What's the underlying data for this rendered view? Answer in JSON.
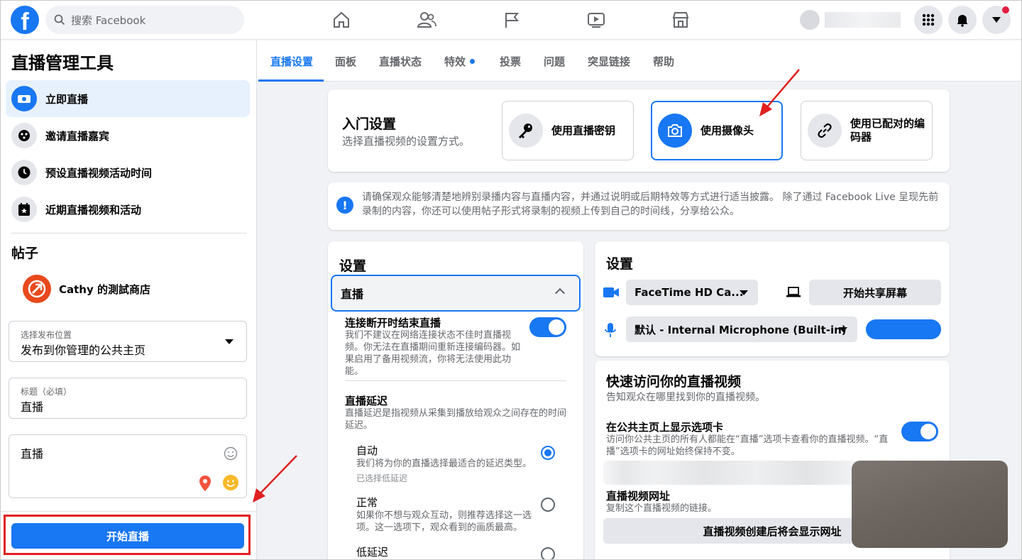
{
  "topbar": {
    "search_placeholder": "搜索 Facebook",
    "icons": [
      "home-icon",
      "friends-icon",
      "pages-flag-icon",
      "watch-icon",
      "marketplace-icon"
    ],
    "right_icons": [
      "menu-grid-icon",
      "bell-icon",
      "account-caret-icon"
    ]
  },
  "sidebar": {
    "title": "直播管理工具",
    "items": [
      {
        "label": "立即直播",
        "icon": "live-camera-icon"
      },
      {
        "label": "邀请直播嘉宾",
        "icon": "guests-icon"
      },
      {
        "label": "预设直播视频活动时间",
        "icon": "clock-icon"
      },
      {
        "label": "近期直播视频和活动",
        "icon": "calendar-star-icon"
      }
    ],
    "posts_heading": "帖子",
    "page_name": "Cathy 的測試商店",
    "post_location": {
      "label": "选择发布位置",
      "value": "发布到你管理的公共主页"
    },
    "title_field": {
      "label": "标题（必填）",
      "value": "直播"
    },
    "description": "直播",
    "go_live_label": "开始直播"
  },
  "tabs": [
    {
      "label": "直播设置",
      "active": true
    },
    {
      "label": "面板"
    },
    {
      "label": "直播状态"
    },
    {
      "label": "特效",
      "dot": true
    },
    {
      "label": "投票"
    },
    {
      "label": "问题"
    },
    {
      "label": "突显链接"
    },
    {
      "label": "帮助"
    }
  ],
  "setup": {
    "title": "入门设置",
    "subtitle": "选择直播视频的设置方式。",
    "methods": [
      {
        "label": "使用直播密钥",
        "icon": "key-icon"
      },
      {
        "label": "使用摄像头",
        "icon": "camera-icon",
        "selected": true
      },
      {
        "label": "使用已配对的编码器",
        "icon": "link-icon"
      }
    ]
  },
  "notice": {
    "text": "请确保观众能够清楚地辨别录播内容与直播内容，并通过说明或后期特效等方式进行适当披露。 除了通过 Facebook Live 呈现先前录制的内容，你还可以使用帖子形式将录制的视频上传到自己的时间线，分享给公众。"
  },
  "settings_left": {
    "title": "设置",
    "section": "直播",
    "end_on_disconnect": {
      "title": "连接断开时结束直播",
      "desc": "我们不建议在网络连接状态不佳时直播视频。你无法在直播期间重新连接编码器。如果启用了备用视频流，你将无法使用此功能。",
      "enabled": true
    },
    "latency": {
      "title": "直播延迟",
      "desc": "直播延迟是指视频从采集到播放给观众之间存在的时间延迟。",
      "options": [
        {
          "title": "自动",
          "desc": "我们将为你的直播选择最适合的延迟类型。",
          "note": "已选择低延迟",
          "selected": true
        },
        {
          "title": "正常",
          "desc": "如果你不想与观众互动，则推荐选择这一选项。这一选项下，观众看到的画质最高。",
          "selected": false
        },
        {
          "title": "低延迟",
          "selected": false
        }
      ]
    }
  },
  "settings_right": {
    "title": "设置",
    "camera": "FaceTime HD Ca...",
    "share_screen": "开始共享屏幕",
    "microphone": "默认 - Internal Microphone (Built-in)",
    "mic_level": 1.0
  },
  "quick_access": {
    "title": "快速访问你的直播视频",
    "subtitle": "告知观众在哪里找到你的直播视频。",
    "show_tab": {
      "title": "在公共主页上显示选项卡",
      "desc": "访问你公共主页的所有人都能在“直播”选项卡查看你的直播视频。“直播”选项卡的网址始终保持不变。",
      "enabled": true
    },
    "url_title": "直播视频网址",
    "url_desc": "复制这个直播视频的链接。",
    "url_button": "直播视频创建后将会显示网址"
  },
  "colors": {
    "accent": "#1877f2",
    "annotation": "#e02020"
  }
}
